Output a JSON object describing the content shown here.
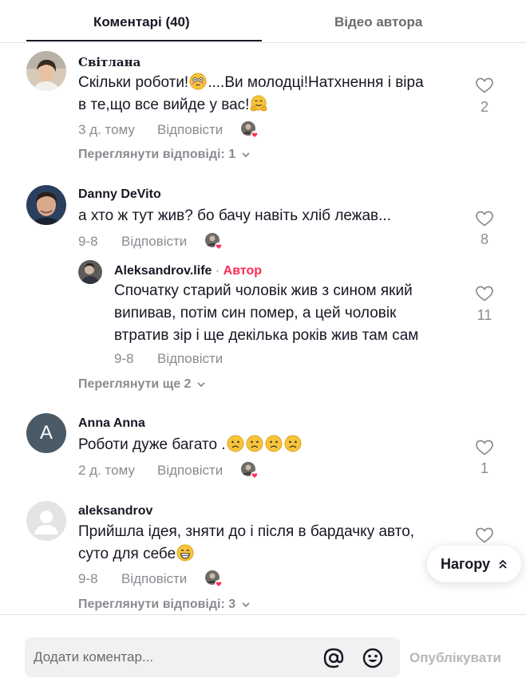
{
  "tabs": {
    "comments": "Коментарі (40)",
    "author_videos": "Відео автора"
  },
  "comments": [
    {
      "user": "Світлана",
      "text_a": "Скільки роботи!",
      "text_b": "....Ви молодці!Натхнення і віра",
      "text_c": "в те,що все вийде у вас!",
      "time": "3 д. тому",
      "reply": "Відповісти",
      "likes": "2",
      "view_replies": "Переглянути відповіді: 1"
    },
    {
      "user": "Danny DeVito",
      "text": "а хто ж тут жив? бо бачу навіть хліб лежав...",
      "time": "9-8",
      "reply": "Відповісти",
      "likes": "8",
      "sub_reply": {
        "user": "Aleksandrov.life",
        "separator": " · ",
        "author_tag": "Автор",
        "line1": "Спочатку старий чоловік жив з сином який",
        "line2": "випивав, потім син помер, а цей чоловік",
        "line3": "втратив зір і ще декілька років жив там сам",
        "time": "9-8",
        "reply": "Відповісти",
        "likes": "11"
      },
      "view_more": "Переглянути ще 2"
    },
    {
      "user": "Anna Anna",
      "avatar_letter": "A",
      "text": "Роботи дуже багато .",
      "time": "2 д. тому",
      "reply": "Відповісти",
      "likes": "1"
    },
    {
      "user": "aleksandrov",
      "line1": "Прийшла ідея, зняти до і після в бардачку авто,",
      "line2": "суто для себе",
      "time": "9-8",
      "reply": "Відповісти",
      "view_replies": "Переглянути відповіді: 3"
    }
  ],
  "scroll_top_button": "Нагору",
  "footer": {
    "placeholder": "Додати коментар...",
    "publish": "Опублікувати"
  },
  "colors": {
    "accent": "#fe2c55",
    "muted": "#8a8b91",
    "text": "#161823",
    "avatar_letter_bg": "#4a5a66"
  }
}
